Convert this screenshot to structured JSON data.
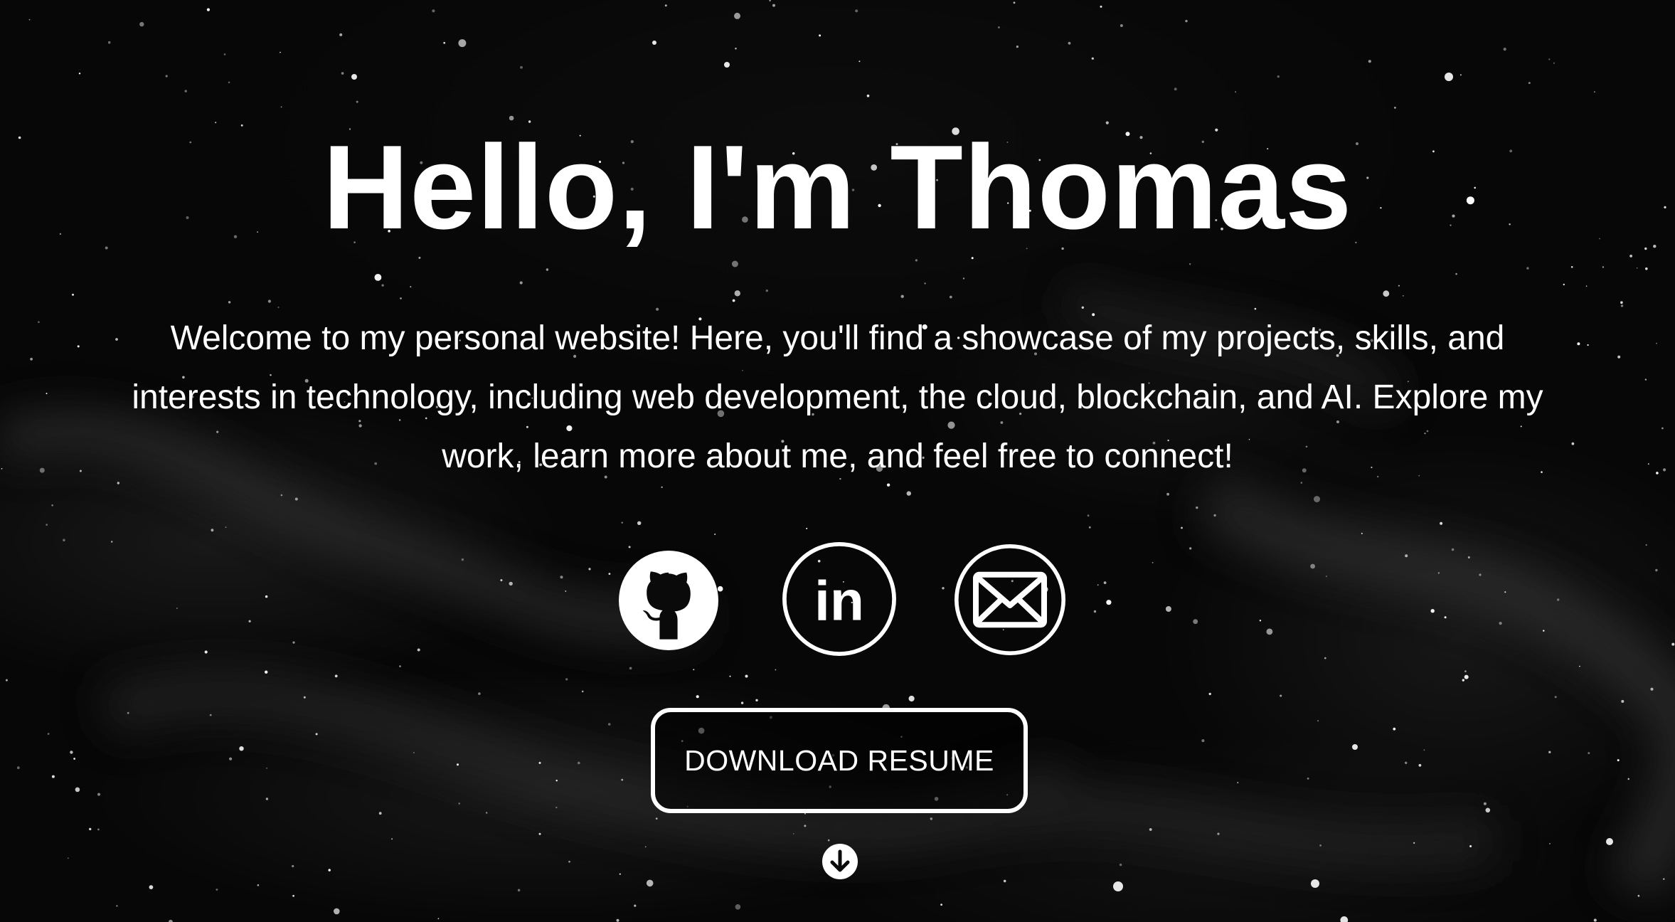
{
  "hero": {
    "title": "Hello, I'm Thomas",
    "intro": "Welcome to my personal website! Here, you'll find a showcase of my projects, skills, and interests in technology, including web development, the cloud, blockchain, and AI. Explore my work, learn more about me, and feel free to connect!",
    "background": "starry-night-sky",
    "text_color": "#ffffff",
    "background_color": "#070707"
  },
  "socials": [
    {
      "icon": "github-icon"
    },
    {
      "icon": "linkedin-icon",
      "glyph": "in"
    },
    {
      "icon": "mail-icon"
    }
  ],
  "resume_button": {
    "label": "DOWNLOAD RESUME"
  },
  "scroll_indicator": {
    "icon": "arrow-down-circle-icon"
  }
}
